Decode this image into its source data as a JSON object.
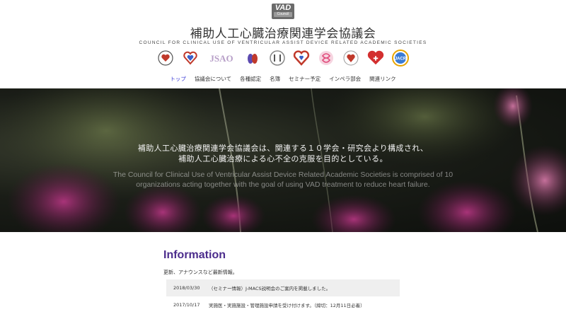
{
  "header": {
    "badge_top": "VAD",
    "badge_bottom": "Council",
    "title": "補助人工心臓治療関連学会協議会",
    "subtitle": "COUNCIL FOR CLINICAL USE OF VENTRICULAR ASSIST DEVICE RELATED ACADEMIC SOCIETIES",
    "member_logos": [
      {
        "icon": "heart-circle-logo",
        "color": "#c0392b"
      },
      {
        "icon": "heart-outline-logo",
        "color": "#c0392b"
      },
      {
        "icon": "jsao-logo",
        "text": "JSAO",
        "color": "#b8a0c8"
      },
      {
        "icon": "heart-organ-logo",
        "color": "#5c4ab0"
      },
      {
        "icon": "cvs-circle-logo",
        "color": "#555555"
      },
      {
        "icon": "heart-red-logo",
        "color": "#c0392b"
      },
      {
        "icon": "pink-knot-logo",
        "color": "#e04a7a"
      },
      {
        "icon": "red-seal-logo",
        "color": "#c0392b"
      },
      {
        "icon": "heart-cross-logo",
        "color": "#d32f2f"
      },
      {
        "icon": "jacr-badge-logo",
        "text": "JACR",
        "color": "#3a7bd5"
      }
    ]
  },
  "nav": {
    "items": [
      {
        "label": "トップ",
        "active": true
      },
      {
        "label": "協議会について",
        "active": false
      },
      {
        "label": "各種認定",
        "active": false
      },
      {
        "label": "名簿",
        "active": false
      },
      {
        "label": "セミナー予定",
        "active": false
      },
      {
        "label": "インペラ部会",
        "active": false
      },
      {
        "label": "関連リンク",
        "active": false
      }
    ],
    "active_color": "#3a3ad6"
  },
  "hero": {
    "jp_line1": "補助人工心臓治療関連学会協議会は、関連する１０学会・研究会より構成され、",
    "jp_line2": "補助人工心臓治療による心不全の克服を目的としている。",
    "en_text": "The Council for Clinical Use of Ventricular Assist Device Related Academic Societies is comprised of 10 organizations acting together with the goal of using VAD treatment to reduce heart failure."
  },
  "information": {
    "heading": "Information",
    "heading_color": "#4b2c8c",
    "description": "更新、アナウンスなど最新情報。",
    "news": [
      {
        "date": "2018/03/30",
        "title": "（セミナー情報）J-MACS説明会のご案内を掲載しました。"
      },
      {
        "date": "2017/10/17",
        "title": "実施医・実施施設・管理施設申請を受け付けます。（締切：12月11日必着）"
      }
    ]
  }
}
